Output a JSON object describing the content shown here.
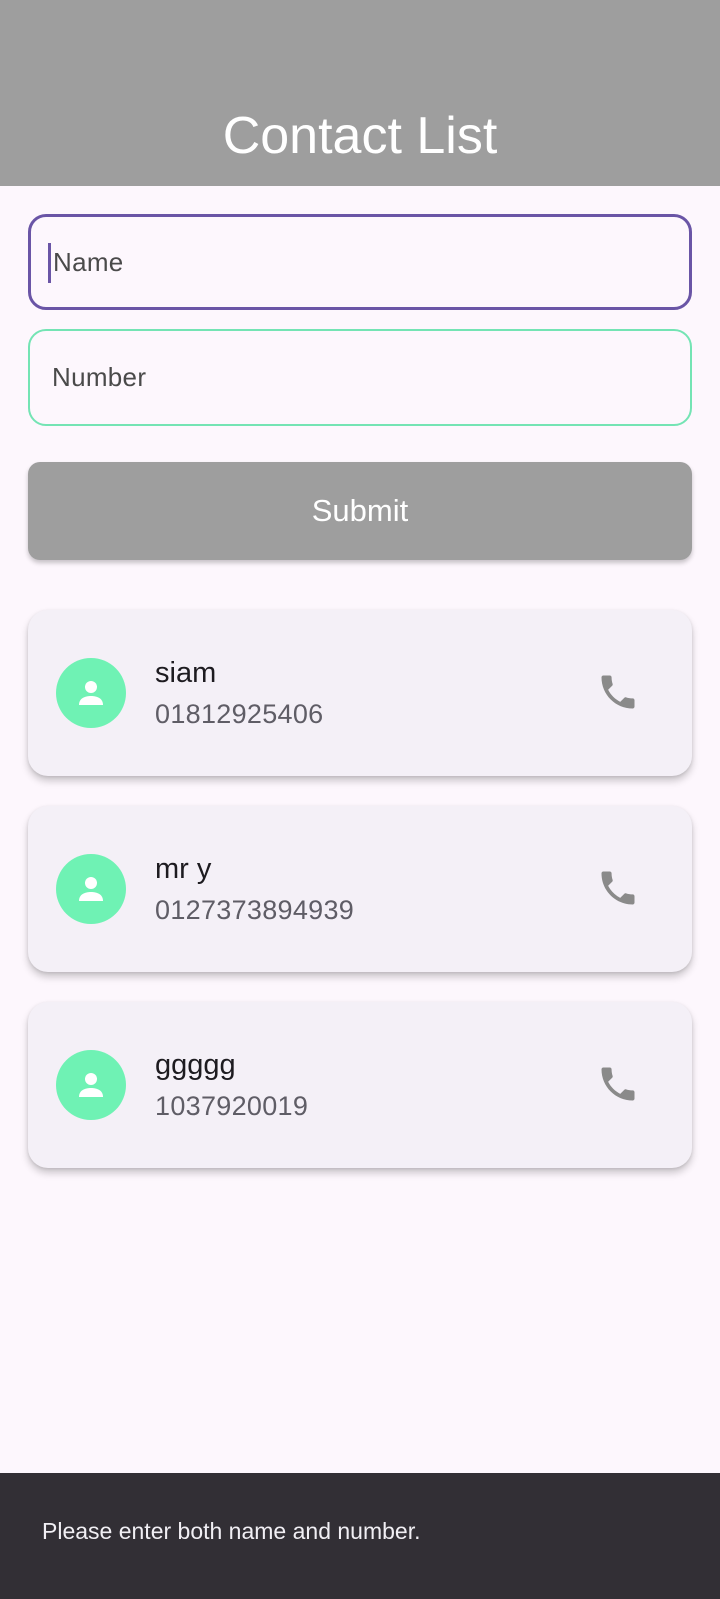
{
  "app_bar": {
    "title": "Contact List",
    "background": "#9e9e9e"
  },
  "form": {
    "name_field": {
      "placeholder": "Name",
      "value": ""
    },
    "number_field": {
      "placeholder": "Number",
      "value": ""
    },
    "submit_label": "Submit"
  },
  "contacts": [
    {
      "name": "siam",
      "number": "01812925406",
      "avatar_icon": "person-icon",
      "action_icon": "phone-icon"
    },
    {
      "name": "mr y",
      "number": "0127373894939",
      "avatar_icon": "person-icon",
      "action_icon": "phone-icon"
    },
    {
      "name": "ggggg",
      "number": "1037920019",
      "avatar_icon": "person-icon",
      "action_icon": "phone-icon"
    }
  ],
  "snackbar": {
    "message": "Please enter both name and number."
  },
  "colors": {
    "focus_border": "#6a55a6",
    "accent_green": "#6ff2b4",
    "card_background": "#f4f0f7",
    "snackbar_background": "#322f35"
  }
}
